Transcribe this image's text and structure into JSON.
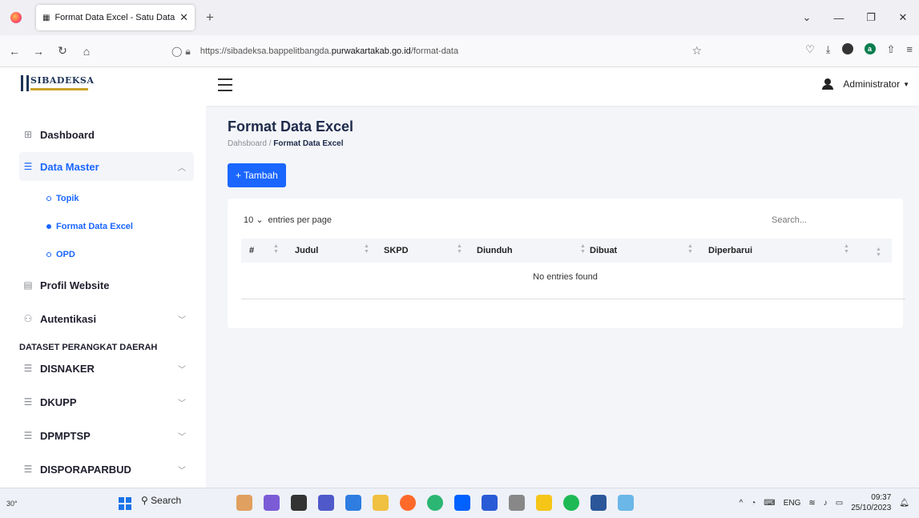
{
  "browser": {
    "tab_title": "Format Data Excel - Satu Data P",
    "url_prefix": "https://sibadeksa.bappelitbangda.",
    "url_host": "purwakartakab.go.id",
    "url_path": "/format-data"
  },
  "app": {
    "brand": "SIBADEKSA",
    "user": "Administrator",
    "page_title": "Format Data Excel",
    "breadcrumb_root": "Dahsboard",
    "breadcrumb_current": "Format Data Excel",
    "add_button": "+ Tambah"
  },
  "sidebar": {
    "dashboard": "Dashboard",
    "data_master": "Data Master",
    "topik": "Topik",
    "format_data_excel": "Format Data Excel",
    "opd": "OPD",
    "profil_website": "Profil Website",
    "autentikasi": "Autentikasi",
    "section_dataset": "DATASET PERANGKAT DAERAH",
    "disnaker": "DISNAKER",
    "dkupp": "DKUPP",
    "dpmptsp": "DPMPTSP",
    "disporaparbud": "DISPORAPARBUD"
  },
  "table": {
    "per_page_value": "10",
    "per_page_label": "entries per page",
    "search_placeholder": "Search...",
    "columns": [
      "#",
      "Judul",
      "SKPD",
      "Diunduh",
      "Dibuat",
      "Diperbarui"
    ],
    "empty_text": "No entries found"
  },
  "taskbar": {
    "weather": "30°",
    "search": "Search",
    "lang": "ENG",
    "time": "09:37",
    "date": "25/10/2023"
  },
  "colors": {
    "accent": "#1a66ff",
    "bg": "#f3f5f9"
  }
}
